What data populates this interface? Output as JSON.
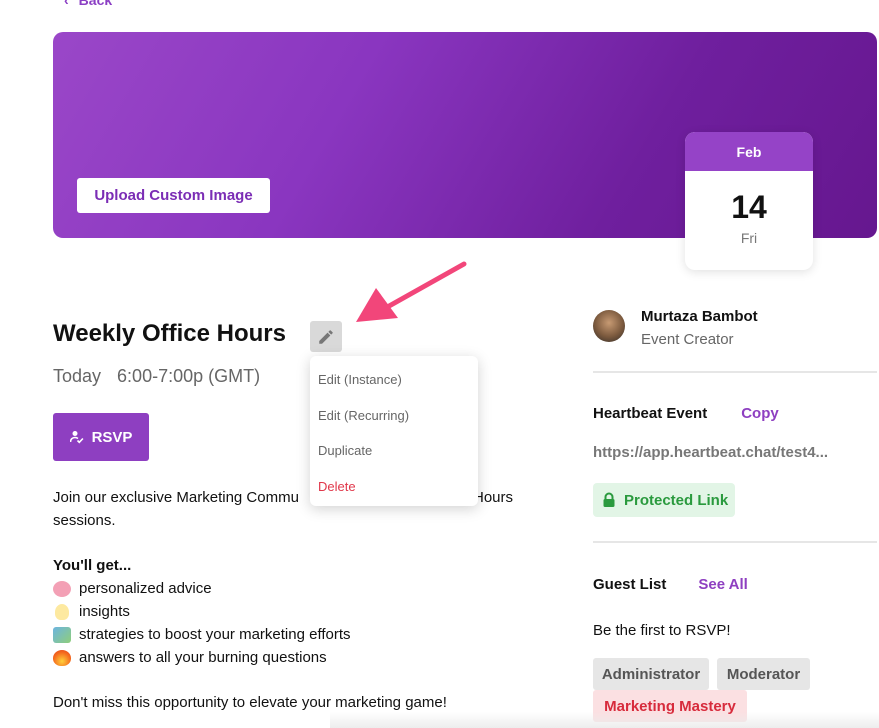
{
  "nav": {
    "back_label": "Back"
  },
  "banner": {
    "upload_label": "Upload Custom Image"
  },
  "date_card": {
    "month": "Feb",
    "day": "14",
    "weekday": "Fri"
  },
  "event": {
    "title": "Weekly Office Hours",
    "date_label": "Today",
    "time_label": "6:00-7:00p (GMT)",
    "rsvp_label": "RSVP"
  },
  "edit_menu": {
    "items": [
      "Edit (Instance)",
      "Edit (Recurring)",
      "Duplicate",
      "Delete"
    ]
  },
  "description": {
    "intro_start": "Join our exclusive Marketing Commu",
    "intro_end": "Hours",
    "intro_line2": "sessions.",
    "gets_heading": "You'll get...",
    "gets": [
      "personalized advice",
      "insights",
      "strategies to boost your marketing efforts",
      "answers to all your burning questions"
    ],
    "closing": "Don't miss this opportunity to elevate your marketing game!"
  },
  "creator": {
    "name": "Murtaza Bambot",
    "role": "Event Creator"
  },
  "heartbeat": {
    "label": "Heartbeat Event",
    "copy_label": "Copy",
    "url": "https://app.heartbeat.chat/test4...",
    "protected_label": "Protected Link"
  },
  "guests": {
    "label": "Guest List",
    "see_all_label": "See All",
    "empty_text": "Be the first to RSVP!",
    "tags": [
      "Administrator",
      "Moderator",
      "Marketing Mastery"
    ]
  },
  "colors": {
    "accent": "#8e3fc1",
    "danger": "#e0374a",
    "success": "#2a9a3e",
    "arrow": "#f2467a"
  }
}
